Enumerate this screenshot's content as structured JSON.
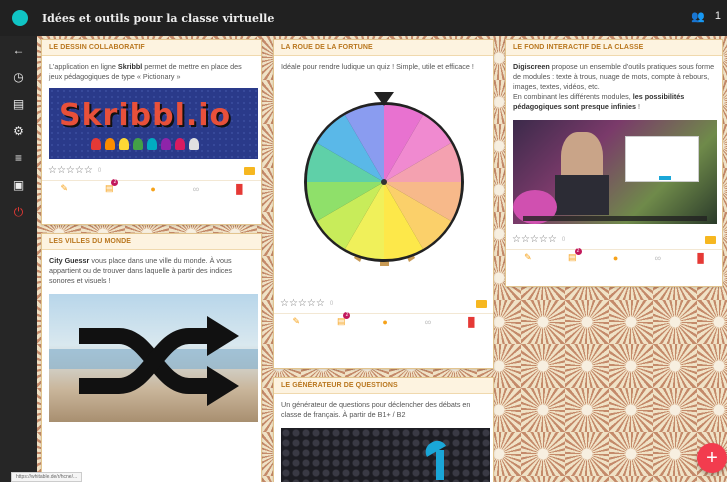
{
  "topbar": {
    "title": "Idées et outils pour la classe virtuelle",
    "users_icon": "people-icon",
    "count": "1"
  },
  "sidebar": {
    "icons": [
      "back-icon",
      "clock-icon",
      "chat-icon",
      "gear-icon",
      "filter-icon",
      "export-icon",
      "power-icon"
    ]
  },
  "cards": {
    "c1": {
      "title": "LE DESSIN COLLABORATIF",
      "text_pre": "L'application en ligne ",
      "text_bold": "Skribbl",
      "text_post": " permet de mettre en place des jeux pédagogiques de type « Pictionary »",
      "image_text": "Skribbl.io",
      "count": "0"
    },
    "c2": {
      "title": "LES VILLES DU MONDE",
      "text_bold": "City Guessr",
      "text_post": " vous place dans une ville du monde. À vous appartient ou de trouver dans laquelle à partir des indices sonores et visuels !"
    },
    "c3": {
      "title": "LA ROUE DE LA FORTUNE",
      "text": "Idéale pour rendre ludique un quiz ! Simple, utile et efficace !",
      "count": "0"
    },
    "c4": {
      "title": "LE GÉNÉRATEUR DE QUESTIONS",
      "text": "Un générateur de questions pour déclencher des débats en classe de français. À partir de B1+ / B2"
    },
    "c5": {
      "title": "LE FOND INTERACTIF DE LA CLASSE",
      "text_bold": "Digiscreen",
      "text_mid": " propose un ensemble d'outils pratiques sous forme de modules : texte à trous, nuage de mots, compte à rebours, images, textes, vidéos, etc.",
      "text_mid2": "En combinant les différents modules, ",
      "text_bold2": "les possibilités pédagogiques sont presque infinies",
      "text_end": " !",
      "count": "0"
    }
  },
  "badge": "2",
  "fab": "+",
  "status_url": "https://whitable.de/r/hcne/..."
}
